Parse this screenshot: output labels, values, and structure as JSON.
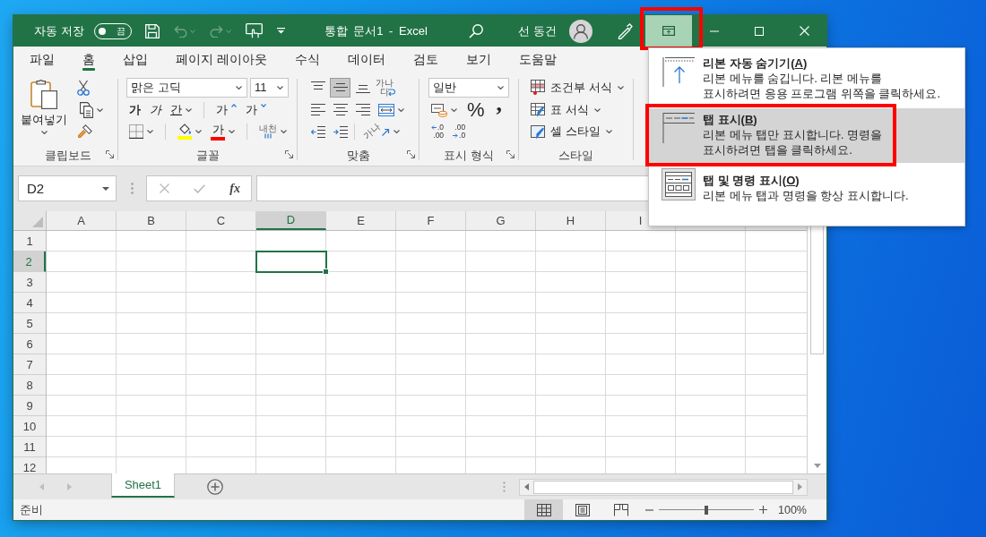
{
  "title_bar": {
    "autosave": {
      "label": "자동 저장",
      "on": false,
      "state_label": "끔"
    },
    "quick_access": [
      {
        "kind": "save",
        "disabled": false
      },
      {
        "kind": "undo",
        "disabled": true
      },
      {
        "kind": "redo",
        "disabled": true
      },
      {
        "kind": "touch_mode",
        "disabled": false
      },
      {
        "kind": "customize",
        "disabled": false
      }
    ],
    "title": "통합 문서1 - Excel",
    "user_name": "선 동건",
    "ribbon_display_button": {
      "pressed": true,
      "highlighted": true
    }
  },
  "ribbon": {
    "tabs": [
      {
        "label": "파일",
        "selected": false
      },
      {
        "label": "홈",
        "selected": true
      },
      {
        "label": "삽입",
        "selected": false
      },
      {
        "label": "페이지 레이아웃",
        "selected": false
      },
      {
        "label": "수식",
        "selected": false
      },
      {
        "label": "데이터",
        "selected": false
      },
      {
        "label": "검토",
        "selected": false
      },
      {
        "label": "보기",
        "selected": false
      },
      {
        "label": "도움말",
        "selected": false
      }
    ],
    "groups": [
      {
        "kind": "clipboard",
        "label": "클립보드",
        "launcher": true,
        "paste_label": "붙여넣기"
      },
      {
        "kind": "font",
        "label": "글꼴",
        "launcher": true,
        "font_name": "맑은 고딕",
        "font_size": "11",
        "style_buttons": [
          {
            "kind": "bold",
            "label": "가"
          },
          {
            "kind": "italic",
            "label": "가"
          },
          {
            "kind": "underline",
            "label": "간"
          }
        ],
        "size_buttons": [
          {
            "kind": "grow",
            "label": "가"
          },
          {
            "kind": "shrink",
            "label": "가"
          }
        ],
        "color_buttons": [
          {
            "kind": "fill",
            "color": "#ffff00"
          },
          {
            "kind": "font",
            "label": "가",
            "color": "#ff0000"
          }
        ],
        "phonetic_label": "내천"
      },
      {
        "kind": "alignment",
        "label": "맞춤",
        "launcher": true,
        "vertical": [
          {
            "kind": "top",
            "selected": false
          },
          {
            "kind": "middle",
            "selected": true
          },
          {
            "kind": "bottom",
            "selected": false
          }
        ],
        "wrap_label": "가나다",
        "orientation_label": "가나"
      },
      {
        "kind": "number",
        "label": "표시 형식",
        "launcher": true,
        "format": "일반",
        "percent_label": "%",
        "comma_label": ",",
        "decimal_buttons": [
          {
            "kind": "increase",
            "top": ".0",
            "bottom": ".00"
          },
          {
            "kind": "decrease",
            "top": ".00",
            "bottom": ".0"
          }
        ]
      },
      {
        "kind": "styles",
        "label": "스타일",
        "launcher": false,
        "commands": [
          {
            "kind": "conditional",
            "label": "조건부 서식"
          },
          {
            "kind": "table",
            "label": "표 서식"
          },
          {
            "kind": "cell",
            "label": "셀 스타일"
          }
        ]
      }
    ]
  },
  "formula_bar": {
    "name_box": "D2",
    "edit_buttons": [
      {
        "kind": "cancel",
        "disabled": true
      },
      {
        "kind": "enter",
        "disabled": true
      },
      {
        "kind": "function",
        "label": "fx",
        "disabled": false
      }
    ]
  },
  "sheet": {
    "columns": [
      {
        "label": "A",
        "selected": false
      },
      {
        "label": "B",
        "selected": false
      },
      {
        "label": "C",
        "selected": false
      },
      {
        "label": "D",
        "selected": true
      },
      {
        "label": "E",
        "selected": false
      },
      {
        "label": "F",
        "selected": false
      },
      {
        "label": "G",
        "selected": false
      },
      {
        "label": "H",
        "selected": false
      },
      {
        "label": "I",
        "selected": false
      }
    ],
    "rows": [
      {
        "label": "1",
        "selected": false
      },
      {
        "label": "2",
        "selected": true
      },
      {
        "label": "3",
        "selected": false
      },
      {
        "label": "4",
        "selected": false
      },
      {
        "label": "5",
        "selected": false
      },
      {
        "label": "6",
        "selected": false
      },
      {
        "label": "7",
        "selected": false
      },
      {
        "label": "8",
        "selected": false
      },
      {
        "label": "9",
        "selected": false
      },
      {
        "label": "10",
        "selected": false
      },
      {
        "label": "11",
        "selected": false
      },
      {
        "label": "12",
        "selected": false
      }
    ]
  },
  "sheet_tabs": {
    "nav": [
      {
        "kind": "previous",
        "disabled": true
      },
      {
        "kind": "next",
        "disabled": true
      }
    ],
    "tabs": [
      {
        "label": "Sheet1",
        "selected": true
      }
    ]
  },
  "status_bar": {
    "status": "준비",
    "views": [
      {
        "kind": "normal",
        "selected": true
      },
      {
        "kind": "page_layout",
        "selected": false
      },
      {
        "kind": "page_break",
        "selected": false
      }
    ],
    "zoom": {
      "level": 0.5,
      "label": "100%"
    }
  },
  "display_menu": {
    "items": [
      {
        "kind": "auto_hide",
        "title": "리본 자동 숨기기(A)",
        "description": [
          "리본 메뉴를 숨깁니다. 리본 메뉴를",
          "표시하려면 응용 프로그램 위쪽을 클릭하세요."
        ],
        "hovered": false,
        "selected": false,
        "highlighted": false
      },
      {
        "kind": "tabs_only",
        "title": "탭 표시(B)",
        "description": [
          "리본 메뉴 탭만 표시합니다. 명령을",
          "표시하려면 탭을 클릭하세요."
        ],
        "hovered": true,
        "selected": false,
        "highlighted": true
      },
      {
        "kind": "tabs_and_commands",
        "title": "탭 및 명령 표시(O)",
        "description": [
          "리본 메뉴 탭과 명령을 항상 표시합니다."
        ],
        "hovered": false,
        "selected": true,
        "highlighted": false
      }
    ]
  }
}
